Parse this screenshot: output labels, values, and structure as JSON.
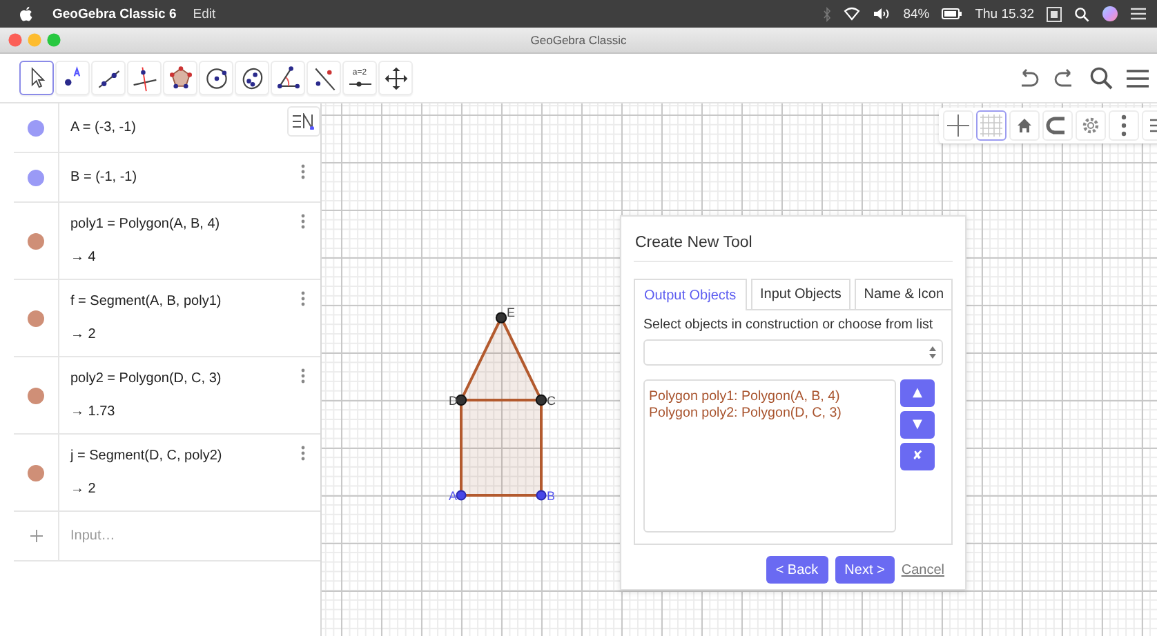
{
  "menubar": {
    "app_name": "GeoGebra Classic 6",
    "menus": [
      "Edit"
    ],
    "battery": "84%",
    "clock": "Thu 15.32"
  },
  "window": {
    "title": "GeoGebra Classic"
  },
  "toolbar": {
    "tools": [
      {
        "kind": "move",
        "selected": true
      },
      {
        "kind": "point",
        "selected": false
      },
      {
        "kind": "line",
        "selected": false
      },
      {
        "kind": "perpendicular",
        "selected": false
      },
      {
        "kind": "polygon",
        "selected": false
      },
      {
        "kind": "circle",
        "selected": false
      },
      {
        "kind": "conic",
        "selected": false
      },
      {
        "kind": "angle",
        "selected": false
      },
      {
        "kind": "reflect",
        "selected": false
      },
      {
        "kind": "slider",
        "selected": false,
        "label": "a=2"
      },
      {
        "kind": "pan",
        "selected": false
      }
    ]
  },
  "algebra": {
    "items": [
      {
        "color": "#9a9af6",
        "formula": "A = (-3, -1)"
      },
      {
        "color": "#9a9af6",
        "formula": "B = (-1, -1)"
      },
      {
        "color": "#cf8f77",
        "formula": "poly1 = Polygon(A, B, 4)",
        "value": "→ 4"
      },
      {
        "color": "#cf8f77",
        "formula": "f = Segment(A, B, poly1)",
        "value": "→ 2"
      },
      {
        "color": "#cf8f77",
        "formula": "poly2 = Polygon(D, C, 3)",
        "value": "→ 1.73"
      },
      {
        "color": "#cf8f77",
        "formula": "j = Segment(D, C, poly2)",
        "value": "→ 2"
      }
    ],
    "input": {
      "placeholder": "Input…"
    }
  },
  "graphics": {
    "style_bar": [
      {
        "kind": "axes",
        "selected": false
      },
      {
        "kind": "grid",
        "selected": true
      },
      {
        "kind": "home",
        "selected": false
      },
      {
        "kind": "capture",
        "selected": false
      },
      {
        "kind": "settings",
        "selected": false
      },
      {
        "kind": "more",
        "selected": false
      },
      {
        "kind": "view",
        "selected": false
      }
    ],
    "points": [
      {
        "label": "A",
        "kind": "free"
      },
      {
        "label": "B",
        "kind": "free"
      },
      {
        "label": "D",
        "kind": "dependent"
      },
      {
        "label": "C",
        "kind": "dependent"
      },
      {
        "label": "E",
        "kind": "dependent"
      }
    ]
  },
  "dialog": {
    "title": "Create New Tool",
    "tabs": [
      {
        "label": "Output Objects",
        "selected": true
      },
      {
        "label": "Input Objects",
        "selected": false
      },
      {
        "label": "Name & Icon",
        "selected": false
      }
    ],
    "instruction": "Select objects in construction or choose from list",
    "objects": [
      "Polygon poly1: Polygon(A, B, 4)",
      "Polygon poly2: Polygon(D, C, 3)"
    ],
    "order_buttons": [
      "▲",
      "▼",
      "✘"
    ],
    "buttons": [
      {
        "label": "< Back",
        "kind": "button"
      },
      {
        "label": "Next >",
        "kind": "button"
      },
      {
        "label": "Cancel",
        "kind": "link"
      }
    ]
  }
}
